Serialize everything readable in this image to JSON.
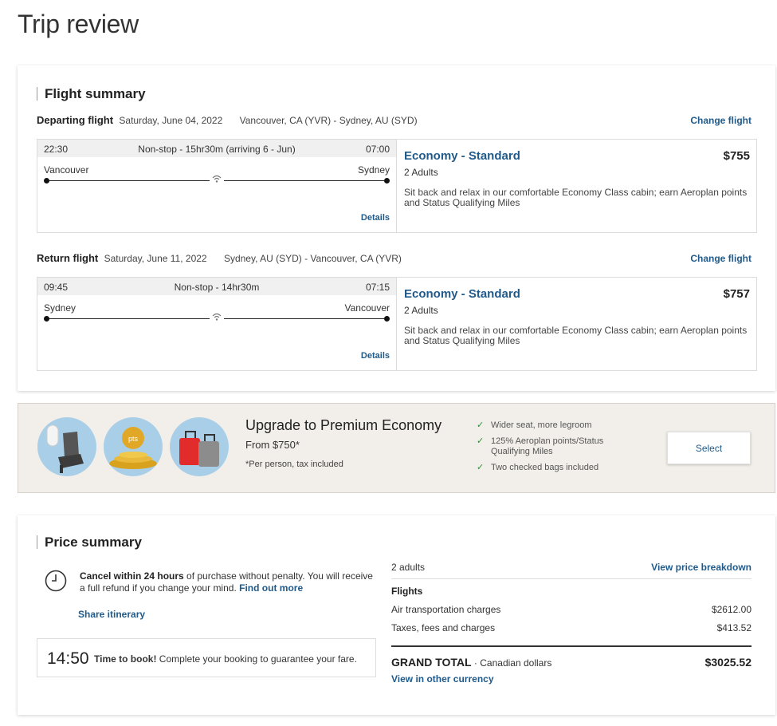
{
  "page_title": "Trip review",
  "flight_summary": {
    "title": "Flight summary",
    "departing": {
      "label": "Departing flight",
      "date": "Saturday, June 04, 2022",
      "route": "Vancouver, CA (YVR) - Sydney, AU (SYD)",
      "change_link": "Change flight",
      "dep_time": "22:30",
      "duration": "Non-stop - 15hr30m (arriving 6 - Jun)",
      "arr_time": "07:00",
      "origin": "Vancouver",
      "destination": "Sydney",
      "details": "Details",
      "cabin": "Economy - Standard",
      "price": "$755",
      "pax": "2 Adults",
      "description": "Sit back and relax in our comfortable Economy Class cabin; earn Aeroplan points and Status Qualifying Miles"
    },
    "return": {
      "label": "Return flight",
      "date": "Saturday, June 11, 2022",
      "route": "Sydney, AU (SYD) - Vancouver, CA (YVR)",
      "change_link": "Change flight",
      "dep_time": "09:45",
      "duration": "Non-stop - 14hr30m",
      "arr_time": "07:15",
      "origin": "Sydney",
      "destination": "Vancouver",
      "details": "Details",
      "cabin": "Economy - Standard",
      "price": "$757",
      "pax": "2 Adults",
      "description": "Sit back and relax in our comfortable Economy Class cabin; earn Aeroplan points and Status Qualifying Miles"
    }
  },
  "upgrade": {
    "title": "Upgrade to Premium Economy",
    "from": "From $750*",
    "note": "*Per person, tax included",
    "icon_pts": "pts",
    "benefits": [
      "Wider seat, more legroom",
      "125% Aeroplan points/Status Qualifying Miles",
      "Two checked bags included"
    ],
    "select_label": "Select"
  },
  "price_summary": {
    "title": "Price summary",
    "cancel_bold": "Cancel within 24 hours",
    "cancel_text": " of purchase without penalty. You will receive a full refund if you change your mind. ",
    "find_out_more": "Find out more",
    "share_itinerary": "Share itinerary",
    "timer": "14:50",
    "timer_bold": "Time to book!",
    "timer_text": " Complete your booking to guarantee your fare.",
    "adults": "2 adults",
    "view_breakdown": "View price breakdown",
    "flights_label": "Flights",
    "rows": [
      {
        "label": "Air transportation charges",
        "value": "$2612.00"
      },
      {
        "label": "Taxes, fees and charges",
        "value": "$413.52"
      }
    ],
    "grand_total_label": "GRAND TOTAL",
    "currency_label": " · Canadian dollars",
    "grand_total": "$3025.52",
    "other_currency": "View in other currency"
  }
}
